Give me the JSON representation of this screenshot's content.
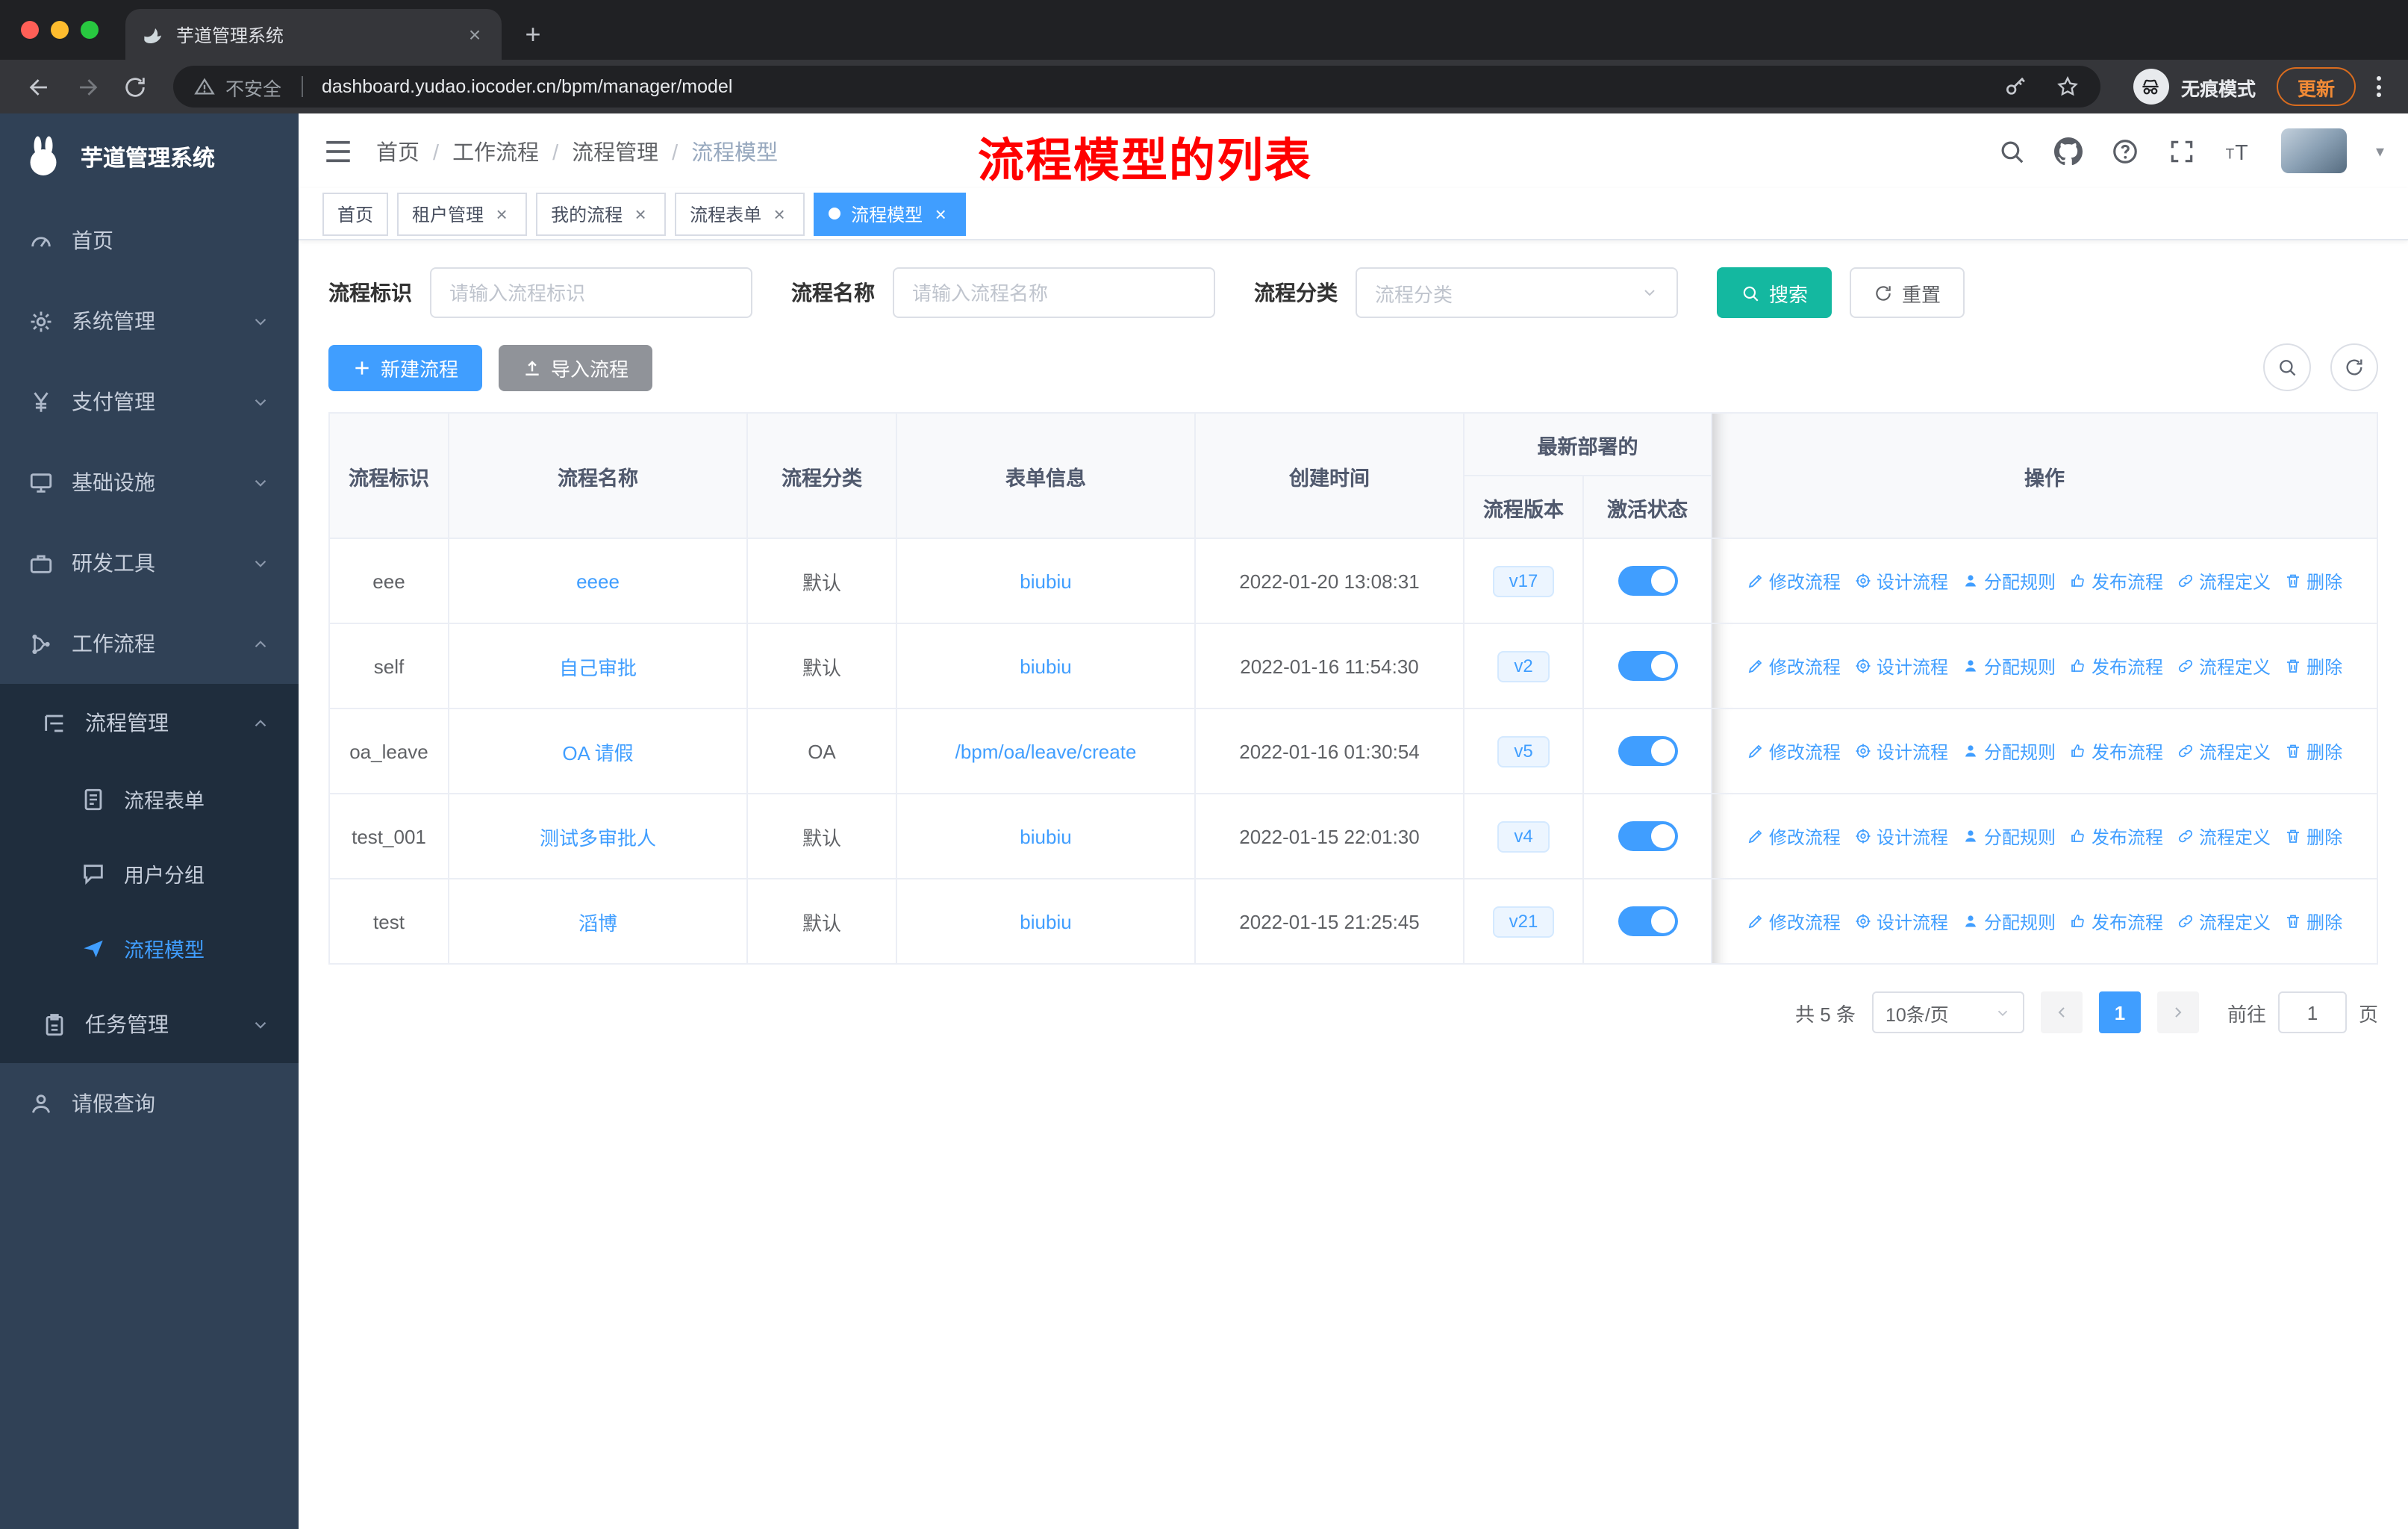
{
  "browser": {
    "tab_title": "芋道管理系统",
    "security_label": "不安全",
    "url": "dashboard.yudao.iocoder.cn/bpm/manager/model",
    "incognito_label": "无痕模式",
    "update_label": "更新"
  },
  "sidebar": {
    "logo_title": "芋道管理系统",
    "menu": [
      {
        "label": "首页"
      },
      {
        "label": "系统管理"
      },
      {
        "label": "支付管理"
      },
      {
        "label": "基础设施"
      },
      {
        "label": "研发工具"
      },
      {
        "label": "工作流程"
      },
      {
        "label": "流程管理"
      },
      {
        "label": "流程表单"
      },
      {
        "label": "用户分组"
      },
      {
        "label": "流程模型"
      },
      {
        "label": "任务管理"
      },
      {
        "label": "请假查询"
      }
    ]
  },
  "header": {
    "breadcrumb": [
      "首页",
      "工作流程",
      "流程管理",
      "流程模型"
    ],
    "annotation": "流程模型的列表"
  },
  "tags": [
    "首页",
    "租户管理",
    "我的流程",
    "流程表单",
    "流程模型"
  ],
  "filters": {
    "id_label": "流程标识",
    "id_placeholder": "请输入流程标识",
    "name_label": "流程名称",
    "name_placeholder": "请输入流程名称",
    "category_label": "流程分类",
    "category_placeholder": "流程分类",
    "search_label": "搜索",
    "reset_label": "重置"
  },
  "toolbar": {
    "create_label": "新建流程",
    "import_label": "导入流程"
  },
  "table": {
    "columns": {
      "id": "流程标识",
      "name": "流程名称",
      "category": "流程分类",
      "form": "表单信息",
      "create_time": "创建时间",
      "group": "最新部署的",
      "version": "流程版本",
      "active": "激活状态",
      "actions": "操作"
    },
    "actions": [
      "修改流程",
      "设计流程",
      "分配规则",
      "发布流程",
      "流程定义",
      "删除"
    ],
    "rows": [
      {
        "id": "eee",
        "name": "eeee",
        "category": "默认",
        "form": "biubiu",
        "create_time": "2022-01-20 13:08:31",
        "version": "v17",
        "active": true
      },
      {
        "id": "self",
        "name": "自己审批",
        "category": "默认",
        "form": "biubiu",
        "create_time": "2022-01-16 11:54:30",
        "version": "v2",
        "active": true
      },
      {
        "id": "oa_leave",
        "name": "OA 请假",
        "category": "OA",
        "form": "/bpm/oa/leave/create",
        "create_time": "2022-01-16 01:30:54",
        "version": "v5",
        "active": true
      },
      {
        "id": "test_001",
        "name": "测试多审批人",
        "category": "默认",
        "form": "biubiu",
        "create_time": "2022-01-15 22:01:30",
        "version": "v4",
        "active": true
      },
      {
        "id": "test",
        "name": "滔博",
        "category": "默认",
        "form": "biubiu",
        "create_time": "2022-01-15 21:25:45",
        "version": "v21",
        "active": true
      }
    ]
  },
  "pagination": {
    "total_label": "共 5 条",
    "page_size": "10条/页",
    "current": "1",
    "goto_label": "前往",
    "goto_value": "1",
    "unit_label": "页"
  },
  "colors": {
    "accent": "#409eff",
    "search_button": "#14b8a0",
    "sidebar_bg": "#304156",
    "sidebar_sub_bg": "#1f2d3d",
    "annotation_red": "#ff0000",
    "gray_button": "#909399",
    "update_orange": "#f08a36",
    "toggle_on": "#409eff"
  },
  "icons": {
    "browser": [
      "back-icon",
      "forward-icon",
      "reload-icon",
      "warning-icon",
      "key-icon",
      "star-icon",
      "incognito-icon",
      "more-vertical-icon",
      "new-tab-icon",
      "close-icon"
    ],
    "header": [
      "hamburger-icon",
      "search-icon",
      "github-icon",
      "question-icon",
      "fullscreen-icon",
      "font-size-icon",
      "caret-down-icon"
    ],
    "row_actions": [
      "edit-icon",
      "design-icon",
      "assign-user-icon",
      "publish-icon",
      "definition-link-icon",
      "delete-icon"
    ]
  }
}
